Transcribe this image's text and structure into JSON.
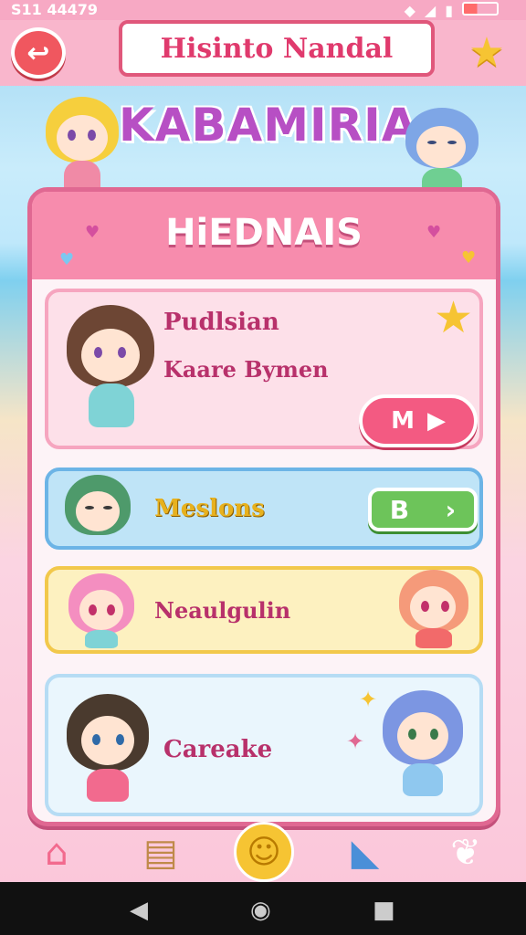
{
  "status_bar": {
    "time": "S11 44479"
  },
  "header": {
    "banner_title": "Hisinto Nandal",
    "logo_title": "KABAMIRIA"
  },
  "panel": {
    "title": "HiEDNAIS"
  },
  "cards": [
    {
      "title": "Pudlsian",
      "subtitle": "Kaare Bymen",
      "button_label": "M"
    },
    {
      "title": "Meslons",
      "button_label": "B"
    },
    {
      "title": "Neaulgulin"
    },
    {
      "title": "Careake"
    }
  ],
  "icons": {
    "back": "back-arrow-icon",
    "favorite": "star-icon",
    "nav": [
      "home-icon",
      "notes-icon",
      "smiley-icon",
      "megaphone-icon",
      "ghost-icon"
    ]
  },
  "colors": {
    "accent_pink": "#f78cad",
    "play_button": "#f35a82",
    "green_button": "#6dc45a"
  }
}
